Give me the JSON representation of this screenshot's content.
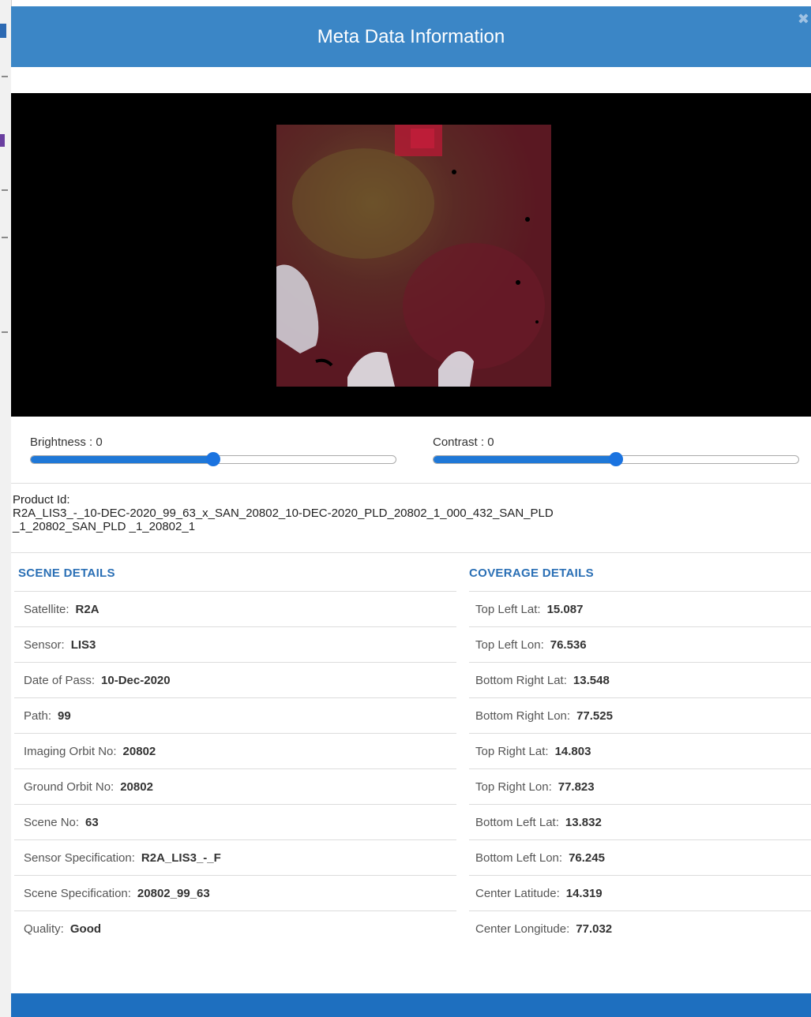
{
  "modal": {
    "title": "Meta Data Information",
    "close_glyph": "✖"
  },
  "adjust": {
    "brightness_label": "Brightness : 0",
    "contrast_label": "Contrast : 0",
    "brightness_level": 0.5,
    "contrast_level": 0.5
  },
  "product": {
    "label": "Product Id:",
    "line1": "R2A_LIS3_-_10-DEC-2020_99_63_x_SAN_20802_10-DEC-2020_PLD_20802_1_000_432_SAN_PLD",
    "line2": "_1_20802_SAN_PLD _1_20802_1"
  },
  "scene_details": {
    "title": "SCENE DETAILS",
    "rows": [
      {
        "label": "Satellite:",
        "value": "R2A"
      },
      {
        "label": "Sensor:",
        "value": "LIS3"
      },
      {
        "label": "Date of Pass:",
        "value": "10-Dec-2020"
      },
      {
        "label": "Path:",
        "value": "99"
      },
      {
        "label": "Imaging Orbit No:",
        "value": "20802"
      },
      {
        "label": "Ground Orbit No:",
        "value": "20802"
      },
      {
        "label": "Scene No:",
        "value": "63"
      },
      {
        "label": "Sensor Specification:",
        "value": "R2A_LIS3_-_F"
      },
      {
        "label": "Scene Specification:",
        "value": "20802_99_63"
      },
      {
        "label": "Quality:",
        "value": "Good"
      }
    ]
  },
  "coverage_details": {
    "title": "COVERAGE DETAILS",
    "rows": [
      {
        "label": "Top Left Lat:",
        "value": "15.087"
      },
      {
        "label": "Top Left Lon:",
        "value": "76.536"
      },
      {
        "label": "Bottom Right Lat:",
        "value": "13.548"
      },
      {
        "label": "Bottom Right Lon:",
        "value": "77.525"
      },
      {
        "label": "Top Right Lat:",
        "value": "14.803"
      },
      {
        "label": "Top Right Lon:",
        "value": "77.823"
      },
      {
        "label": "Bottom Left Lat:",
        "value": "13.832"
      },
      {
        "label": "Bottom Left Lon:",
        "value": "76.245"
      },
      {
        "label": "Center Latitude:",
        "value": "14.319"
      },
      {
        "label": "Center Longitude:",
        "value": "77.032"
      }
    ]
  },
  "colors": {
    "header": "#3b86c6",
    "accent": "#2a6fb5",
    "slider": "#1f78d7",
    "footer": "#1e6fbf"
  }
}
